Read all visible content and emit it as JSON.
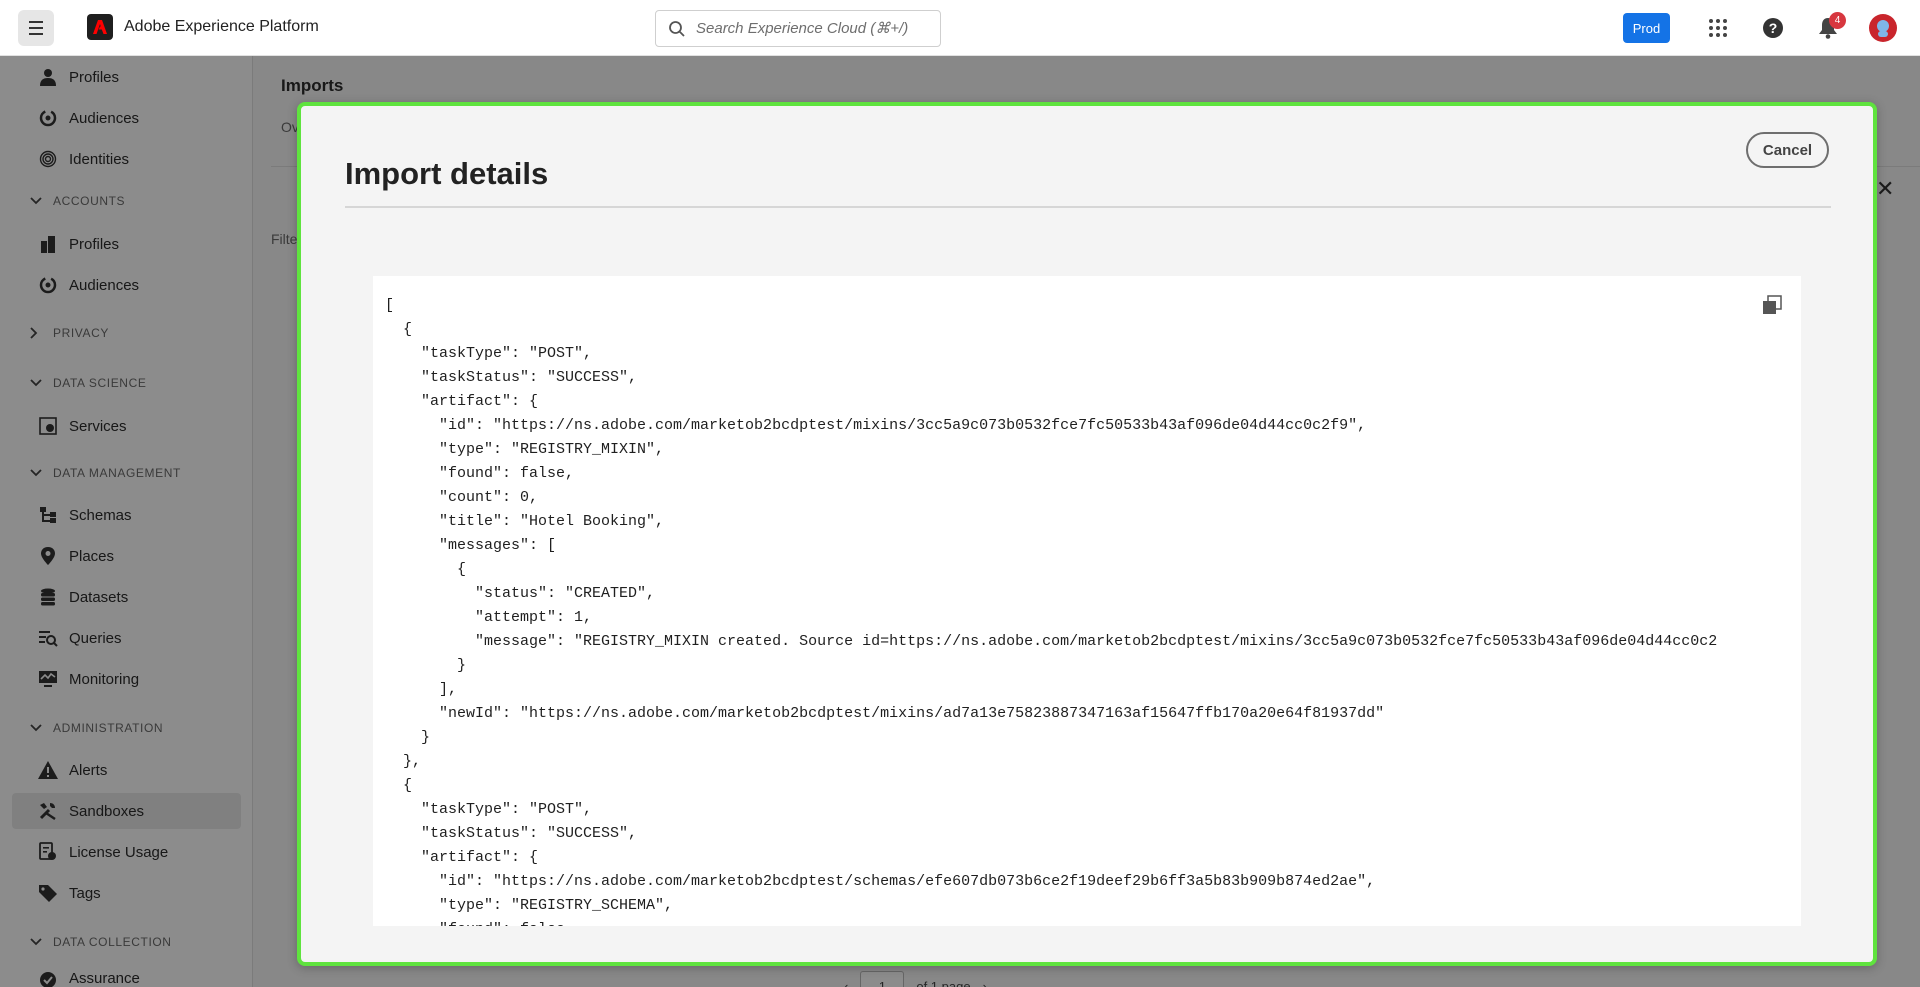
{
  "topbar": {
    "app_name": "Adobe Experience Platform",
    "search_placeholder": "Search Experience Cloud (⌘+/)",
    "sandbox_label": "Prod",
    "notification_count": "4"
  },
  "sidebar": {
    "items": [
      {
        "type": "item",
        "label": "Profiles",
        "icon": "person-icon"
      },
      {
        "type": "item",
        "label": "Audiences",
        "icon": "audiences-icon"
      },
      {
        "type": "item",
        "label": "Identities",
        "icon": "fingerprint-icon"
      },
      {
        "type": "section",
        "label": "ACCOUNTS",
        "expanded": true
      },
      {
        "type": "item",
        "label": "Profiles",
        "icon": "building-icon"
      },
      {
        "type": "item",
        "label": "Audiences",
        "icon": "audiences-icon"
      },
      {
        "type": "section",
        "label": "PRIVACY",
        "expanded": false
      },
      {
        "type": "section",
        "label": "DATA SCIENCE",
        "expanded": true
      },
      {
        "type": "item",
        "label": "Services",
        "icon": "services-icon"
      },
      {
        "type": "section",
        "label": "DATA MANAGEMENT",
        "expanded": true
      },
      {
        "type": "item",
        "label": "Schemas",
        "icon": "schema-icon"
      },
      {
        "type": "item",
        "label": "Places",
        "icon": "pin-icon"
      },
      {
        "type": "item",
        "label": "Datasets",
        "icon": "database-icon"
      },
      {
        "type": "item",
        "label": "Queries",
        "icon": "queries-icon"
      },
      {
        "type": "item",
        "label": "Monitoring",
        "icon": "monitoring-icon"
      },
      {
        "type": "section",
        "label": "ADMINISTRATION",
        "expanded": true
      },
      {
        "type": "item",
        "label": "Alerts",
        "icon": "alert-icon"
      },
      {
        "type": "item",
        "label": "Sandboxes",
        "icon": "tools-icon",
        "active": true
      },
      {
        "type": "item",
        "label": "License Usage",
        "icon": "license-icon"
      },
      {
        "type": "item",
        "label": "Tags",
        "icon": "tag-icon"
      },
      {
        "type": "section",
        "label": "DATA COLLECTION",
        "expanded": true
      },
      {
        "type": "item",
        "label": "Assurance",
        "icon": "assurance-icon"
      }
    ]
  },
  "main": {
    "title": "Imports",
    "tab_partial": "Ov",
    "filter_partial": "Filte",
    "pager_page": "1",
    "pager_of": "of 1 page"
  },
  "dialog": {
    "title": "Import details",
    "cancel_label": "Cancel",
    "code_lines": [
      "[",
      "  {",
      "    \"taskType\": \"POST\",",
      "    \"taskStatus\": \"SUCCESS\",",
      "    \"artifact\": {",
      "      \"id\": \"https://ns.adobe.com/marketob2bcdptest/mixins/3cc5a9c073b0532fce7fc50533b43af096de04d44cc0c2f9\",",
      "      \"type\": \"REGISTRY_MIXIN\",",
      "      \"found\": false,",
      "      \"count\": 0,",
      "      \"title\": \"Hotel Booking\",",
      "      \"messages\": [",
      "        {",
      "          \"status\": \"CREATED\",",
      "          \"attempt\": 1,",
      "          \"message\": \"REGISTRY_MIXIN created. Source id=https://ns.adobe.com/marketob2bcdptest/mixins/3cc5a9c073b0532fce7fc50533b43af096de04d44cc0c2",
      "        }",
      "      ],",
      "      \"newId\": \"https://ns.adobe.com/marketob2bcdptest/mixins/ad7a13e75823887347163af15647ffb170a20e64f81937dd\"",
      "    }",
      "  },",
      "  {",
      "    \"taskType\": \"POST\",",
      "    \"taskStatus\": \"SUCCESS\",",
      "    \"artifact\": {",
      "      \"id\": \"https://ns.adobe.com/marketob2bcdptest/schemas/efe607db073b6ce2f19deef29b6ff3a5b83b909b874ed2ae\",",
      "      \"type\": \"REGISTRY_SCHEMA\",",
      "      \"found\": false,"
    ]
  }
}
